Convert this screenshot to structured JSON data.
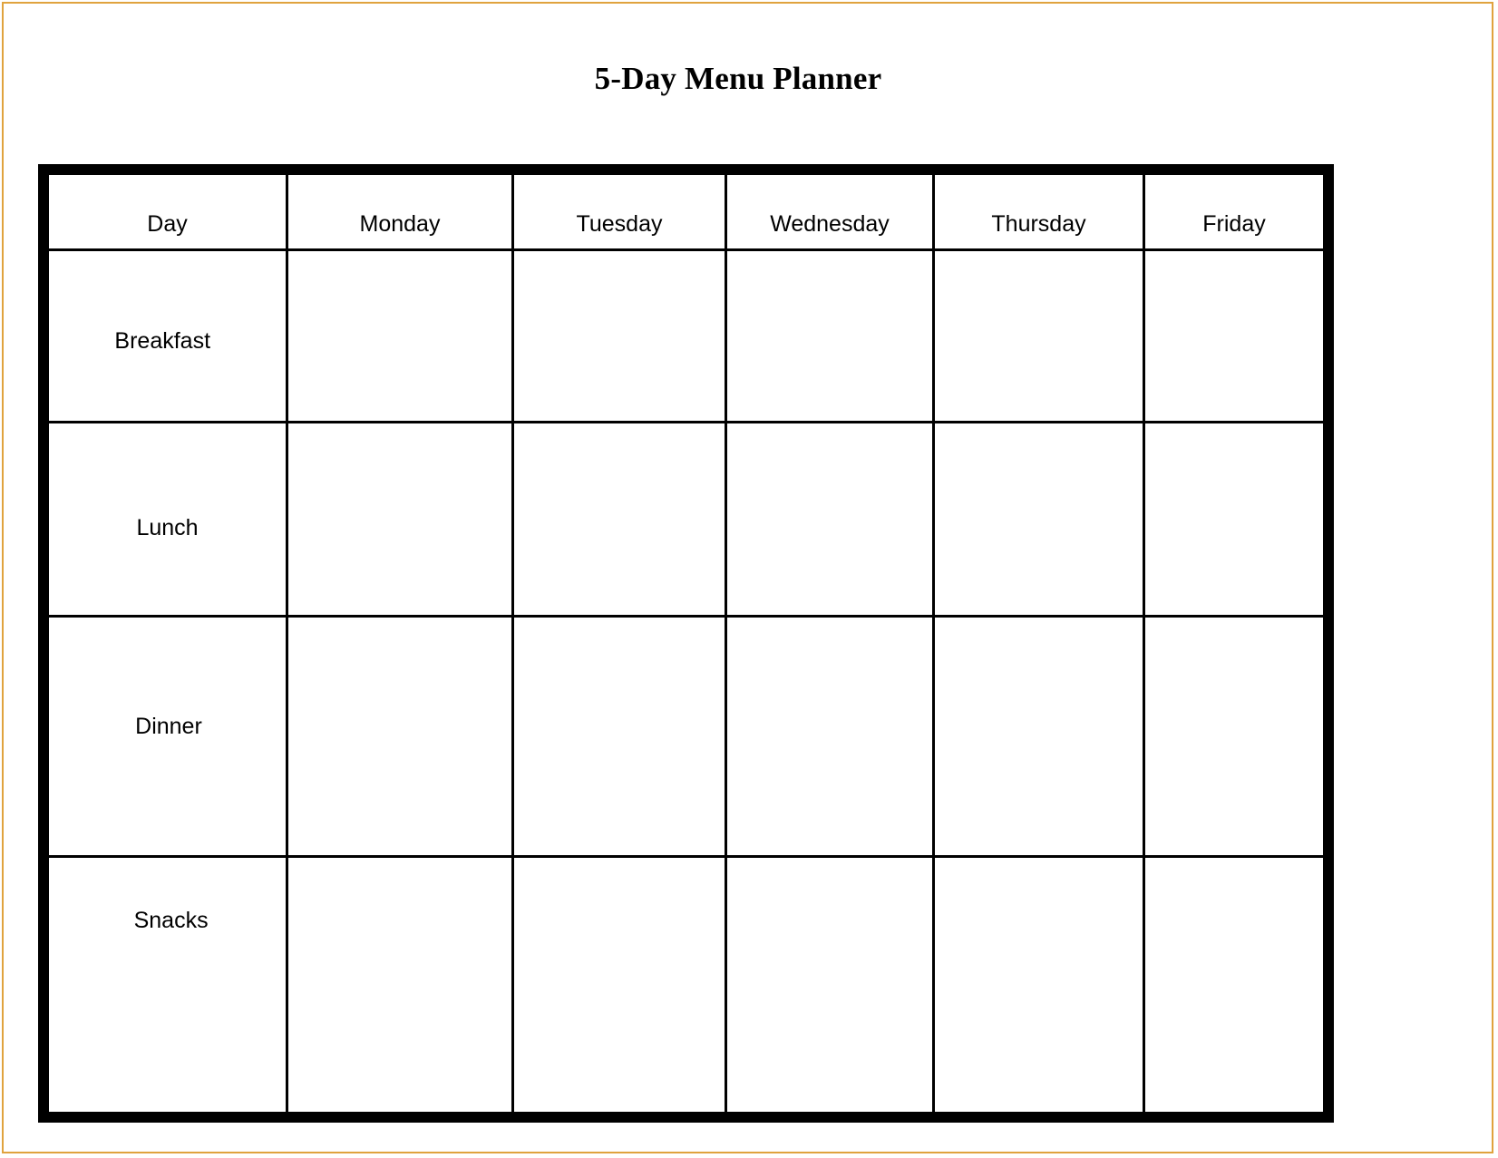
{
  "page": {
    "title": "5-Day Menu Planner",
    "border_color": "#e0a33e",
    "table_border_color": "#000000",
    "background_color": "#ffffff"
  },
  "table": {
    "columns": [
      {
        "key": "day",
        "label": "Day"
      },
      {
        "key": "monday",
        "label": "Monday"
      },
      {
        "key": "tuesday",
        "label": "Tuesday"
      },
      {
        "key": "wednesday",
        "label": "Wednesday"
      },
      {
        "key": "thursday",
        "label": "Thursday"
      },
      {
        "key": "friday",
        "label": "Friday"
      }
    ],
    "rows": [
      {
        "key": "breakfast",
        "label": "Breakfast",
        "cells": [
          "",
          "",
          "",
          "",
          ""
        ]
      },
      {
        "key": "lunch",
        "label": "Lunch",
        "cells": [
          "",
          "",
          "",
          "",
          ""
        ]
      },
      {
        "key": "dinner",
        "label": "Dinner",
        "cells": [
          "",
          "",
          "",
          "",
          ""
        ]
      },
      {
        "key": "snacks",
        "label": "Snacks",
        "cells": [
          "",
          "",
          "",
          "",
          ""
        ]
      }
    ]
  }
}
